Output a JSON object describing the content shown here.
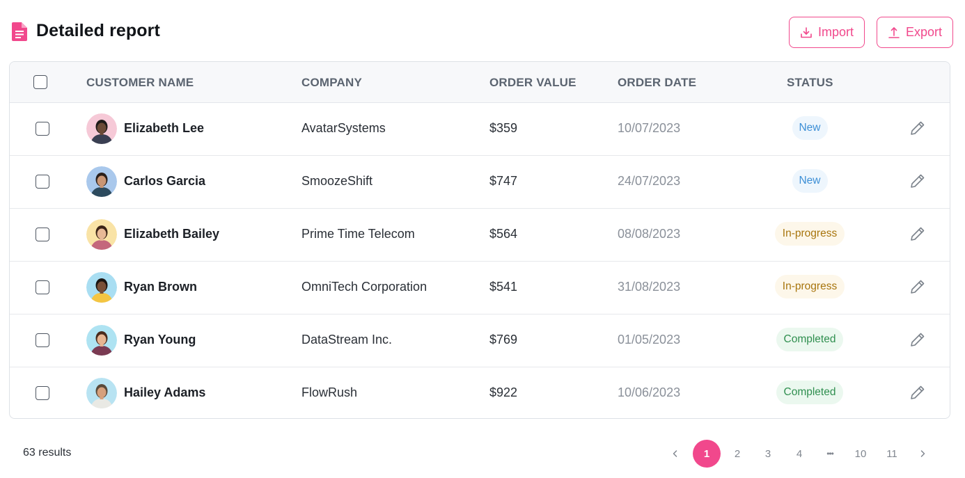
{
  "page": {
    "title": "Detailed report",
    "import_label": "Import",
    "export_label": "Export"
  },
  "colors": {
    "accent": "#f1488c",
    "new_bg": "#eef6fd",
    "new_fg": "#3d8fd6",
    "progress_bg": "#fdf7ea",
    "progress_fg": "#a8750d",
    "completed_bg": "#ebf8ef",
    "completed_fg": "#2f8f4f"
  },
  "table": {
    "columns": [
      "CUSTOMER NAME",
      "COMPANY",
      "ORDER VALUE",
      "ORDER DATE",
      "STATUS"
    ],
    "rows": [
      {
        "name": "Elizabeth Lee",
        "company": "AvatarSystems",
        "value": "$359",
        "date": "10/07/2023",
        "status": "New",
        "status_kind": "new"
      },
      {
        "name": "Carlos Garcia",
        "company": "SmoozeShift",
        "value": "$747",
        "date": "24/07/2023",
        "status": "New",
        "status_kind": "new"
      },
      {
        "name": "Elizabeth Bailey",
        "company": "Prime Time Telecom",
        "value": "$564",
        "date": "08/08/2023",
        "status": "In-progress",
        "status_kind": "progress"
      },
      {
        "name": "Ryan Brown",
        "company": "OmniTech Corporation",
        "value": "$541",
        "date": "31/08/2023",
        "status": "In-progress",
        "status_kind": "progress"
      },
      {
        "name": "Ryan Young",
        "company": "DataStream Inc.",
        "value": "$769",
        "date": "01/05/2023",
        "status": "Completed",
        "status_kind": "completed"
      },
      {
        "name": "Hailey Adams",
        "company": "FlowRush",
        "value": "$922",
        "date": "10/06/2023",
        "status": "Completed",
        "status_kind": "completed"
      }
    ]
  },
  "footer": {
    "results": "63 results",
    "pages": [
      "1",
      "2",
      "3",
      "4",
      "•••",
      "10",
      "11"
    ],
    "active_page": "1"
  }
}
